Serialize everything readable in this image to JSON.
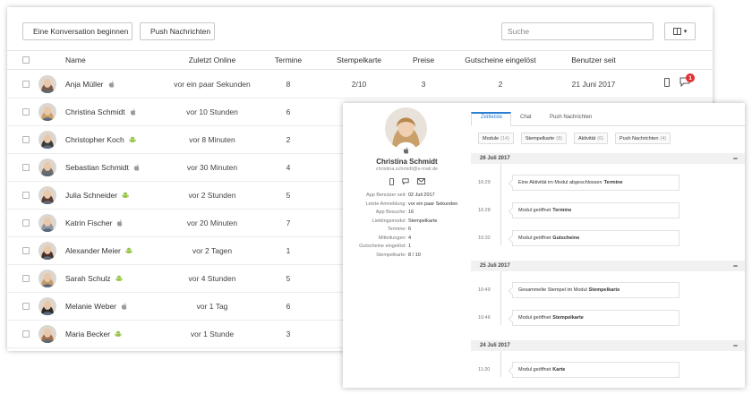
{
  "toolbar": {
    "conversation_label": "Eine Konversation beginnen",
    "push_label": "Push Nachrichten",
    "search_placeholder": "Suche"
  },
  "table": {
    "headers": {
      "name": "Name",
      "last_online": "Zuletzt Online",
      "appointments": "Termine",
      "stamp_card": "Stempelkarte",
      "prizes": "Preise",
      "vouchers": "Gutscheine eingelöst",
      "user_since": "Benutzer seit"
    },
    "rows": [
      {
        "name": "Anja Müller",
        "os": "apple",
        "last_online": "vor ein paar Sekunden",
        "appointments": "8",
        "stamp_card": "2/10",
        "prizes": "3",
        "vouchers": "2",
        "user_since": "21 Juni 2017",
        "chat_badge": "1",
        "avatar_color": "#7a5a48"
      },
      {
        "name": "Christina Schmidt",
        "os": "apple",
        "last_online": "vor 10 Stunden",
        "appointments": "6",
        "avatar_color": "#c9a06a"
      },
      {
        "name": "Christopher Koch",
        "os": "android",
        "last_online": "vor 8 Minuten",
        "appointments": "2",
        "avatar_color": "#3b3b3b"
      },
      {
        "name": "Sebastian Schmidt",
        "os": "apple",
        "last_online": "vor 30 Minuten",
        "appointments": "4",
        "avatar_color": "#6d6d6d"
      },
      {
        "name": "Julia Schneider",
        "os": "android",
        "last_online": "vor 2 Stunden",
        "appointments": "5",
        "avatar_color": "#5a3b32"
      },
      {
        "name": "Katrin Fischer",
        "os": "apple",
        "last_online": "vor 20 Minuten",
        "appointments": "7",
        "avatar_color": "#8e96a3"
      },
      {
        "name": "Alexander Meier",
        "os": "android",
        "last_online": "vor 2 Tagen",
        "appointments": "1",
        "avatar_color": "#4a3028"
      },
      {
        "name": "Sarah Schulz",
        "os": "android",
        "last_online": "vor 4 Stunden",
        "appointments": "5",
        "avatar_color": "#c49a6c"
      },
      {
        "name": "Melanie Weber",
        "os": "apple",
        "last_online": "vor 1 Tag",
        "appointments": "6",
        "avatar_color": "#2f2a2a"
      },
      {
        "name": "Maria Becker",
        "os": "android",
        "last_online": "vor 1 Stunde",
        "appointments": "3",
        "avatar_color": "#a06e4e"
      }
    ]
  },
  "profile": {
    "name": "Christina Schmidt",
    "email": "christina.schmidt@e-mail.de",
    "avatar_color": "#c9a06a",
    "info": [
      {
        "key": "App Benutzer seit:",
        "value": "02 Juli 2017"
      },
      {
        "key": "Letzte Anmeldung:",
        "value": "vor ein paar Sekunden"
      },
      {
        "key": "App Besuche:",
        "value": "16"
      },
      {
        "key": "Lieblingsmodul:",
        "value": "Stempelkarte"
      },
      {
        "key": "Termine:",
        "value": "6"
      },
      {
        "key": "Mitteilungen:",
        "value": "4"
      },
      {
        "key": "Gutscheine eingelöst:",
        "value": "1"
      },
      {
        "key": "Stempelkarte:",
        "value": "8 / 10"
      }
    ]
  },
  "detail_tabs": [
    "Zeitleiste",
    "Chat",
    "Push Nachrichten"
  ],
  "filters": [
    {
      "label": "Module",
      "count": "(14)"
    },
    {
      "label": "Stempelkarte",
      "count": "(8)"
    },
    {
      "label": "Aktivität",
      "count": "(6)"
    },
    {
      "label": "Push Nachrichten",
      "count": "(4)"
    }
  ],
  "timeline": [
    {
      "date": "26 Juli 2017",
      "events": [
        {
          "time": "16:29",
          "text": "Eine Aktivität im Modul abgeschlossen",
          "bold": "Termine"
        },
        {
          "time": "16:28",
          "text": "Modul geöffnet",
          "bold": "Termine"
        },
        {
          "time": "10:32",
          "text": "Modul geöffnet",
          "bold": "Gutscheine"
        }
      ]
    },
    {
      "date": "25 Juli 2017",
      "events": [
        {
          "time": "10:49",
          "text": "Gesammelte Stempel im Modul",
          "bold": "Stempelkarte"
        },
        {
          "time": "10:46",
          "text": "Modul geöffnet",
          "bold": "Stempelkarte"
        }
      ]
    },
    {
      "date": "24 Juli 2017",
      "events": [
        {
          "time": "11:20",
          "text": "Modul geöffnet",
          "bold": "Karte"
        }
      ]
    }
  ],
  "icons": {
    "chat": "chat-bubble-icon",
    "phone": "phone-icon",
    "apple": "apple-icon",
    "android": "android-icon",
    "mail": "mail-icon",
    "columns": "columns-icon"
  },
  "colors": {
    "accent": "#2a7fd4",
    "badge": "#e03131",
    "android": "#97c447",
    "apple": "#9a9a9a"
  }
}
